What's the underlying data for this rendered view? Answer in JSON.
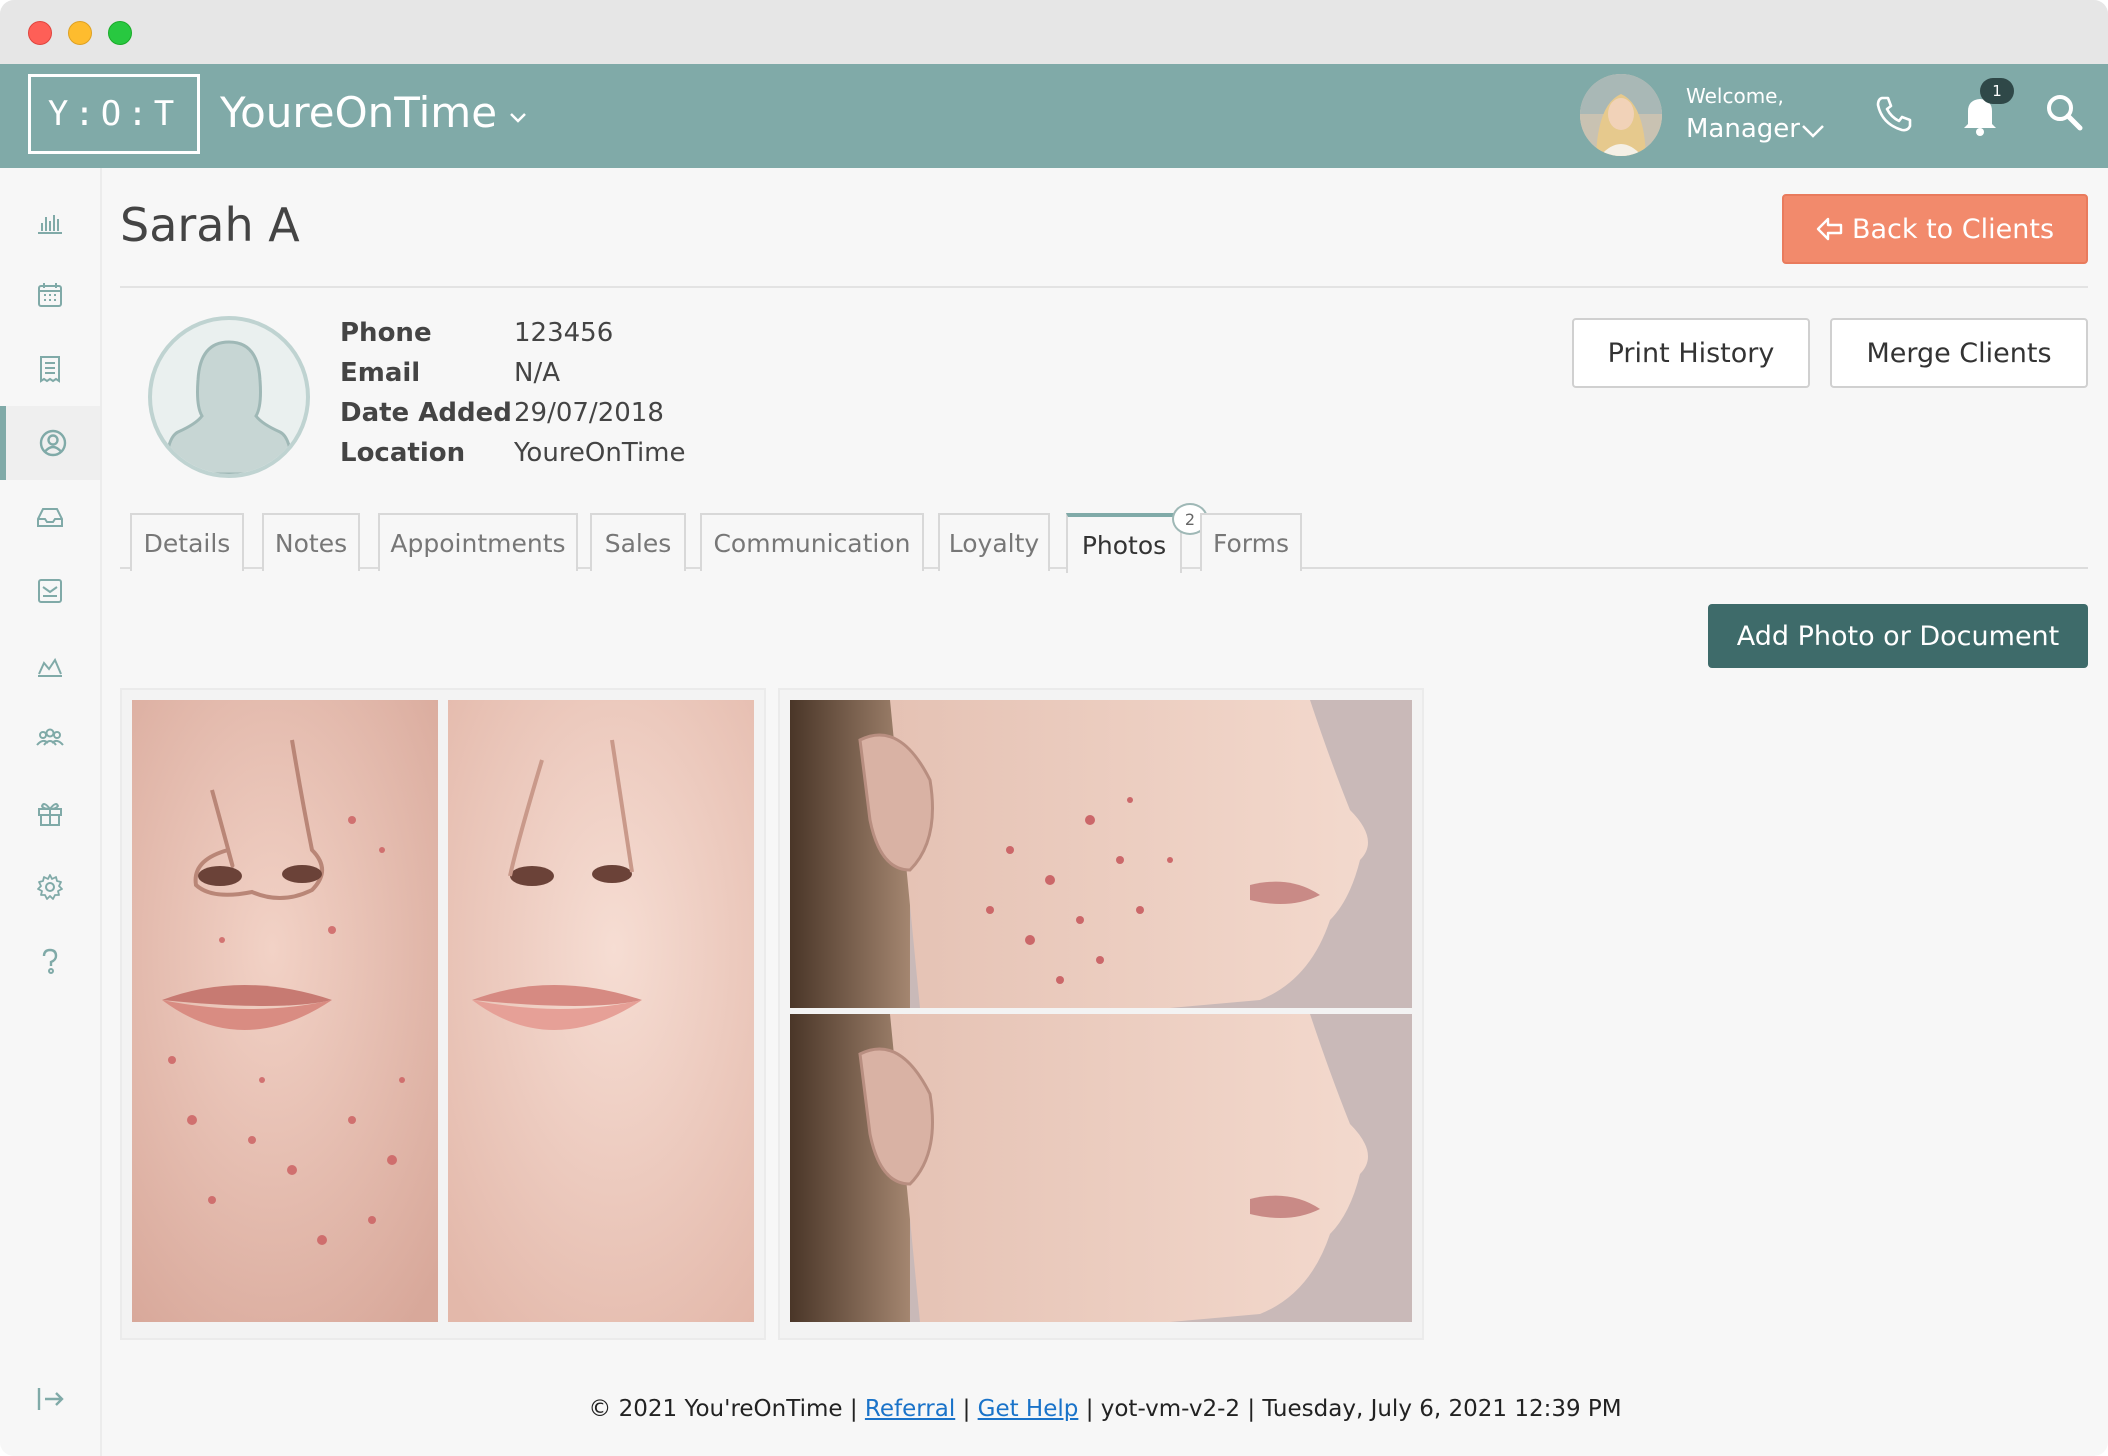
{
  "header": {
    "logo_text": "Y:O:T",
    "brand": "YoureOnTime",
    "welcome": "Welcome,",
    "user_role": "Manager",
    "notification_count": "1"
  },
  "sidebar": {
    "items": [
      {
        "icon": "bar-chart-icon"
      },
      {
        "icon": "calendar-icon"
      },
      {
        "icon": "receipt-icon"
      },
      {
        "icon": "user-circle-icon",
        "active": true
      },
      {
        "icon": "inbox-icon"
      },
      {
        "icon": "mail-icon"
      },
      {
        "icon": "area-chart-icon"
      },
      {
        "icon": "users-icon"
      },
      {
        "icon": "gift-icon"
      },
      {
        "icon": "gear-icon"
      },
      {
        "icon": "help-icon"
      }
    ],
    "logout_icon": "logout-icon"
  },
  "client": {
    "name": "Sarah A",
    "fields": [
      {
        "label": "Phone",
        "value": "123456"
      },
      {
        "label": "Email",
        "value": "N/A"
      },
      {
        "label": "Date Added",
        "value": "29/07/2018"
      },
      {
        "label": "Location",
        "value": "YoureOnTime"
      }
    ]
  },
  "actions": {
    "back": "Back to Clients",
    "print_history": "Print History",
    "merge_clients": "Merge Clients",
    "add_photo": "Add Photo or Document"
  },
  "tabs": [
    {
      "label": "Details"
    },
    {
      "label": "Notes"
    },
    {
      "label": "Appointments"
    },
    {
      "label": "Sales"
    },
    {
      "label": "Communication"
    },
    {
      "label": "Loyalty"
    },
    {
      "label": "Photos",
      "active": true,
      "badge": "2"
    },
    {
      "label": "Forms"
    }
  ],
  "photos": [
    {
      "name": "before-after-front"
    },
    {
      "name": "before-after-profile"
    }
  ],
  "footer": {
    "copyright": "© 2021 You'reOnTime |",
    "referral": "Referral",
    "sep1": "|",
    "get_help": "Get Help",
    "rest": "| yot-vm-v2-2 | Tuesday, July 6, 2021  12:39 PM"
  },
  "colors": {
    "header": "#80aaa8",
    "back_button": "#f28a6c",
    "add_button": "#3e6b6a"
  }
}
